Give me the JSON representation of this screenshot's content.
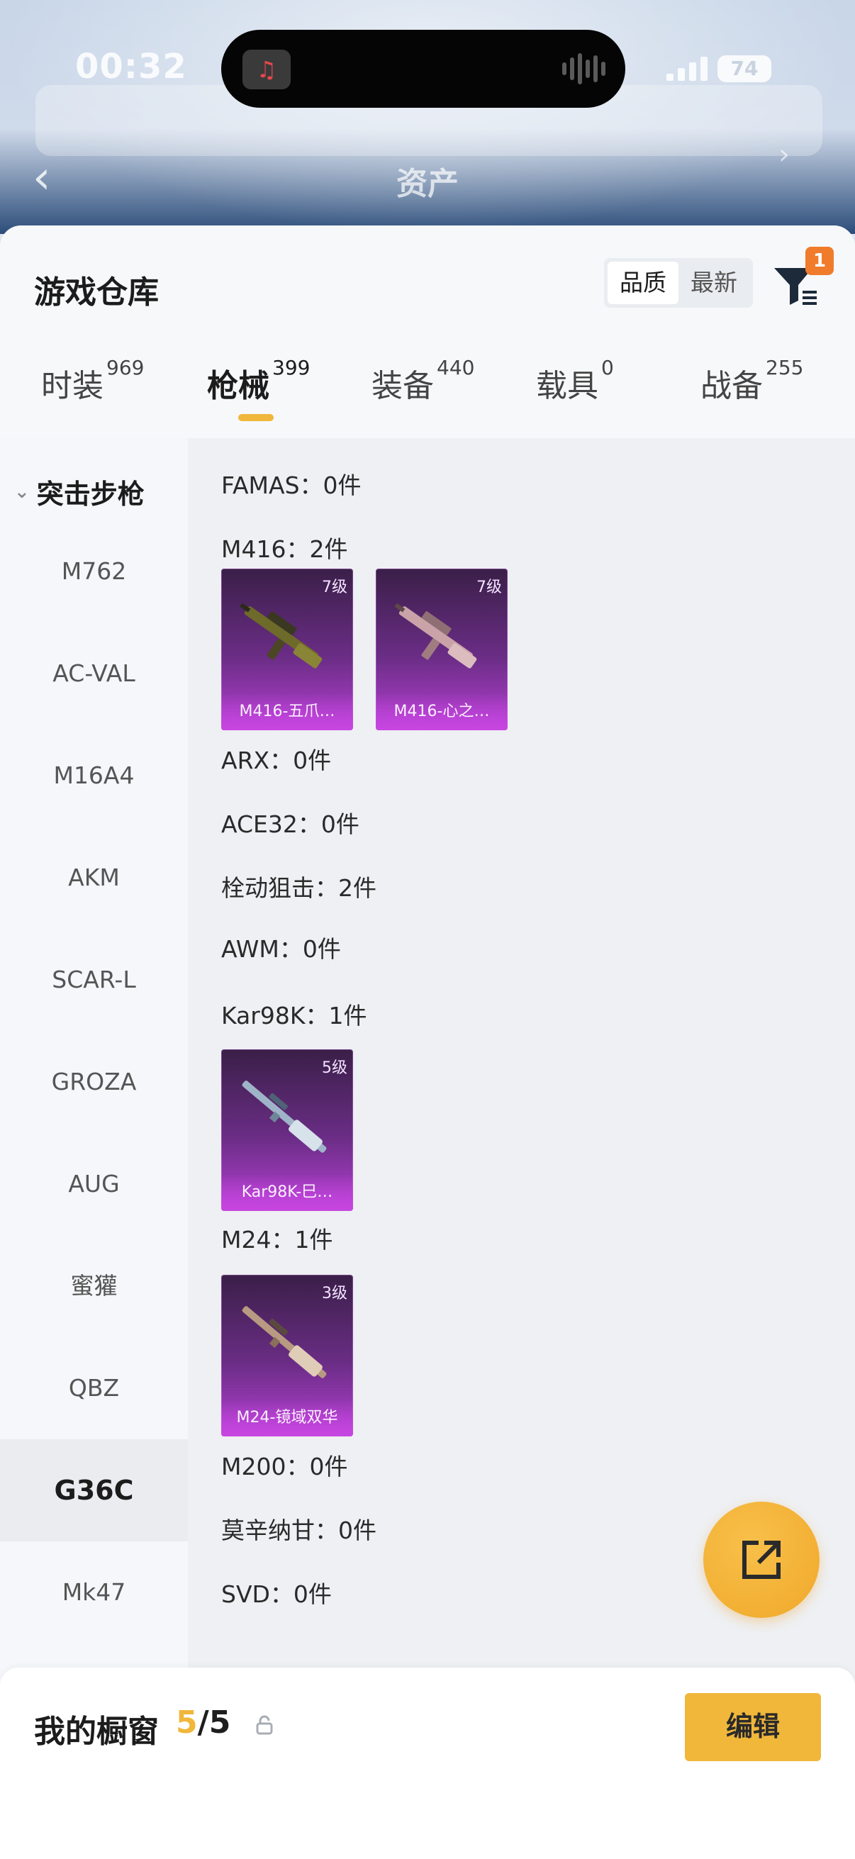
{
  "status_bar": {
    "time": "00:32",
    "battery": "74"
  },
  "background": {
    "title": "资产"
  },
  "header": {
    "title": "游戏仓库",
    "sort_options": [
      "品质",
      "最新"
    ],
    "sort_active": "品质",
    "filter_badge": "1"
  },
  "tabs": [
    {
      "label": "时装",
      "count": "969"
    },
    {
      "label": "枪械",
      "count": "399",
      "active": true
    },
    {
      "label": "装备",
      "count": "440"
    },
    {
      "label": "载具",
      "count": "0"
    },
    {
      "label": "战备",
      "count": "255"
    }
  ],
  "sidebar": {
    "group": "突击步枪",
    "items": [
      "M762",
      "AC-VAL",
      "M16A4",
      "AKM",
      "SCAR-L",
      "GROZA",
      "AUG",
      "蜜獾",
      "QBZ",
      "G36C",
      "Mk47"
    ],
    "active": "G36C"
  },
  "sections": [
    {
      "label": "FAMAS：0件"
    },
    {
      "label": "M416：2件",
      "cards": [
        {
          "grade": "7级",
          "name": "M416-五爪…"
        },
        {
          "grade": "7级",
          "name": "M416-心之…"
        }
      ]
    },
    {
      "label": "ARX：0件"
    },
    {
      "label": "ACE32：0件"
    },
    {
      "label": "栓动狙击：2件"
    },
    {
      "label": "AWM：0件"
    },
    {
      "label": "Kar98K：1件",
      "cards": [
        {
          "grade": "5级",
          "name": "Kar98K-巳…"
        }
      ]
    },
    {
      "label": "M24：1件",
      "cards": [
        {
          "grade": "3级",
          "name": "M24-镜域双华"
        }
      ]
    },
    {
      "label": "M200：0件"
    },
    {
      "label": "莫辛纳甘：0件"
    },
    {
      "label": "SVD：0件"
    }
  ],
  "showcase": {
    "title": "我的橱窗",
    "current": "5",
    "separator": "/",
    "total": "5",
    "edit_label": "编辑"
  },
  "colors": {
    "accent": "#f0b73a",
    "badge": "#f07b2a",
    "rarity_purple": "#b640d4"
  }
}
